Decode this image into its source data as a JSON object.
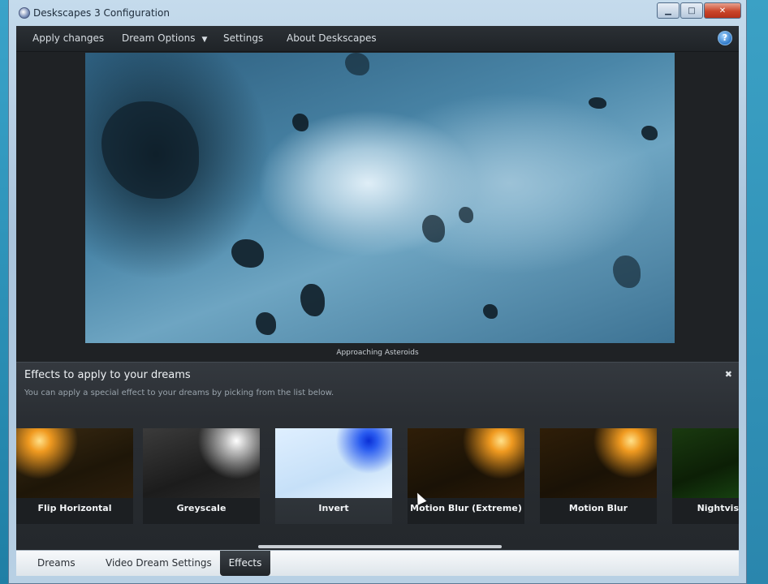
{
  "window": {
    "title": "Deskscapes 3 Configuration",
    "minimize_icon": "minimize-icon",
    "maximize_icon": "maximize-icon",
    "close_icon": "close-icon"
  },
  "menu": {
    "items": [
      {
        "label": "Apply changes"
      },
      {
        "label": "Dream Options"
      },
      {
        "label": "Settings"
      },
      {
        "label": "About Deskscapes"
      }
    ],
    "help_icon": "help-icon"
  },
  "preview": {
    "caption": "Approaching Asteroids"
  },
  "effects": {
    "title": "Effects to apply to your dreams",
    "subtitle": "You can apply a special effect to your dreams by picking from the list below.",
    "close_icon": "close-icon",
    "items": [
      {
        "label": "Flip Horizontal"
      },
      {
        "label": "Greyscale"
      },
      {
        "label": "Invert"
      },
      {
        "label": "Motion Blur (Extreme)"
      },
      {
        "label": "Motion Blur"
      },
      {
        "label": "Nightvis"
      }
    ]
  },
  "tabs": {
    "items": [
      {
        "label": "Dreams"
      },
      {
        "label": "Video Dream Settings"
      },
      {
        "label": "Effects"
      }
    ],
    "active": "Effects"
  },
  "colors": {
    "accent": "#2d78c8",
    "client_bg": "#202326",
    "text_light": "#d7dde2"
  }
}
